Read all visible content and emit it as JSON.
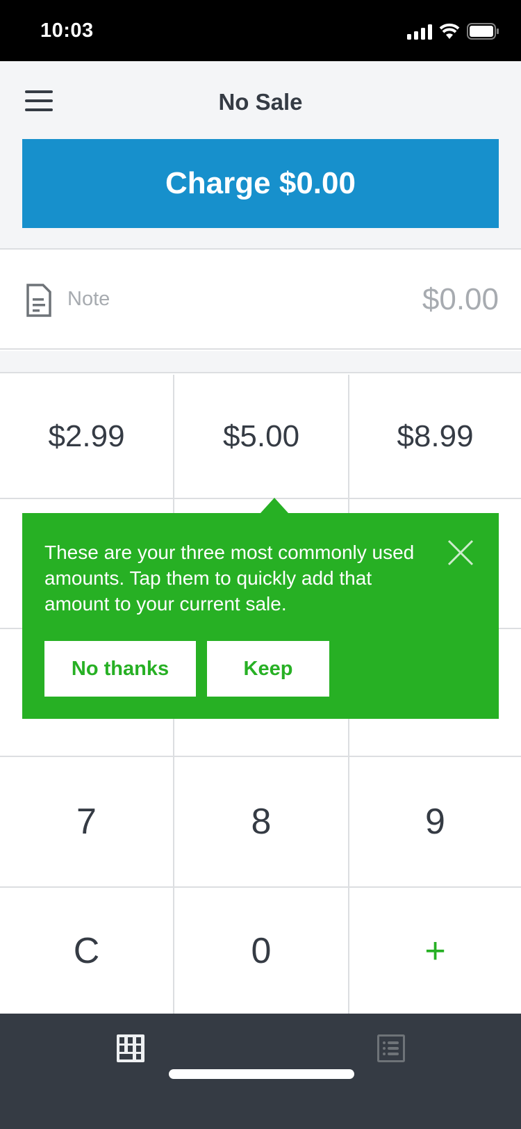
{
  "status_bar": {
    "time": "10:03",
    "icons": [
      "cellular-signal-icon",
      "wifi-icon",
      "battery-icon"
    ]
  },
  "header": {
    "title": "No Sale",
    "menu_icon": "hamburger-menu-icon"
  },
  "charge_button": {
    "label": "Charge $0.00",
    "color": "#1790cc"
  },
  "note_row": {
    "icon": "note-document-icon",
    "placeholder": "Note",
    "amount": "$0.00"
  },
  "quick_amounts": [
    "$2.99",
    "$5.00",
    "$8.99"
  ],
  "keypad": {
    "row_789": [
      "7",
      "8",
      "9"
    ],
    "bottom_row": [
      "C",
      "0",
      "+"
    ]
  },
  "tooltip": {
    "text": "These are your three most commonly used amounts. Tap them to quickly add that amount to your current sale.",
    "no_thanks": "No thanks",
    "keep": "Keep",
    "color": "#27b024"
  },
  "tab_bar": {
    "tabs": [
      {
        "icon": "keypad-icon",
        "active": true
      },
      {
        "icon": "library-list-icon",
        "active": false
      }
    ]
  }
}
